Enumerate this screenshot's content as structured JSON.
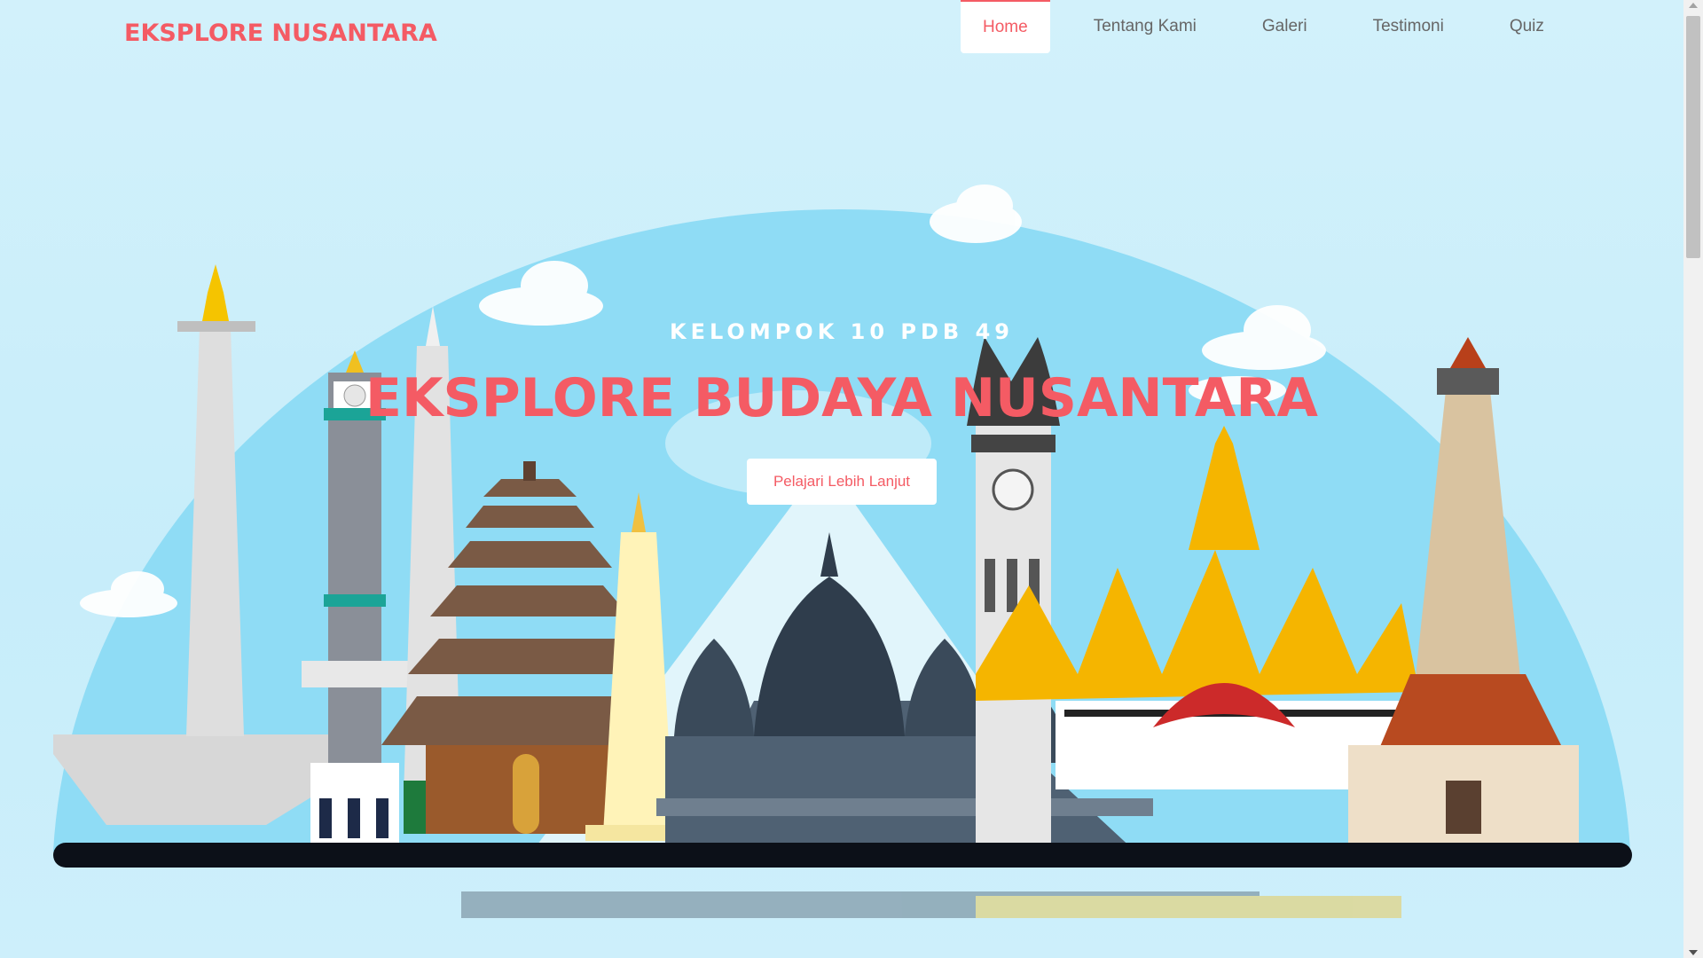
{
  "brand": {
    "name": "EKSPLORE NUSANTARA"
  },
  "nav": {
    "items": [
      {
        "label": "Home",
        "active": true
      },
      {
        "label": "Tentang Kami",
        "active": false
      },
      {
        "label": "Galeri",
        "active": false
      },
      {
        "label": "Testimoni",
        "active": false
      },
      {
        "label": "Quiz",
        "active": false
      }
    ]
  },
  "hero": {
    "subtitle": "KELOMPOK 10 PDB 49",
    "title": "EKSPLORE BUDAYA NUSANTARA",
    "cta_label": "Pelajari Lebih Lanjut"
  },
  "colors": {
    "accent": "#f45b64",
    "sky": "#cfeffa",
    "dome": "#8fdcf5",
    "nav_text": "#666666"
  },
  "icons": {
    "scroll_up": "triangle-up-icon",
    "scroll_down": "triangle-down-icon"
  }
}
